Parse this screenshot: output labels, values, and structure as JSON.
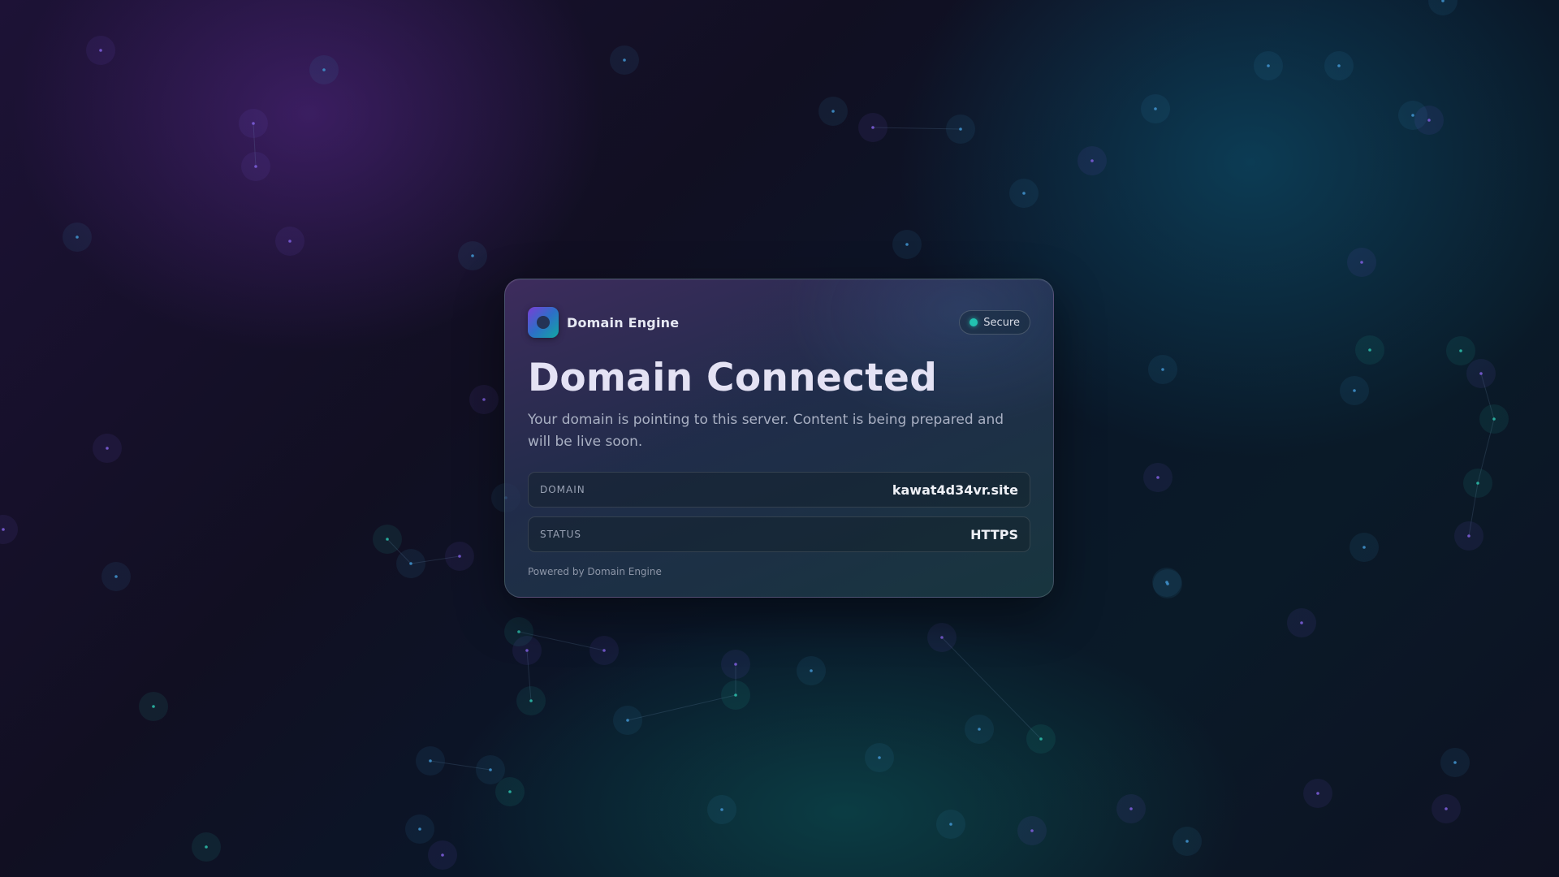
{
  "card": {
    "brand_name": "Domain Engine",
    "logo_icon": "domain-engine-logo-icon",
    "badge": {
      "label": "Secure",
      "icon": "status-dot-icon",
      "dot_color": "#22c2b0"
    },
    "title": "Domain Connected",
    "description": "Your domain is pointing to this server. Content is being prepared and will be live soon.",
    "rows": [
      {
        "label": "DOMAIN",
        "value": "kawat4d34vr.site"
      },
      {
        "label": "STATUS",
        "value": "HTTPS"
      }
    ],
    "footer": "Powered by Domain Engine"
  },
  "colors": {
    "accent_teal": "#22c2b0",
    "accent_purple": "#7b3fd6",
    "background_dark": "#0a1628"
  }
}
